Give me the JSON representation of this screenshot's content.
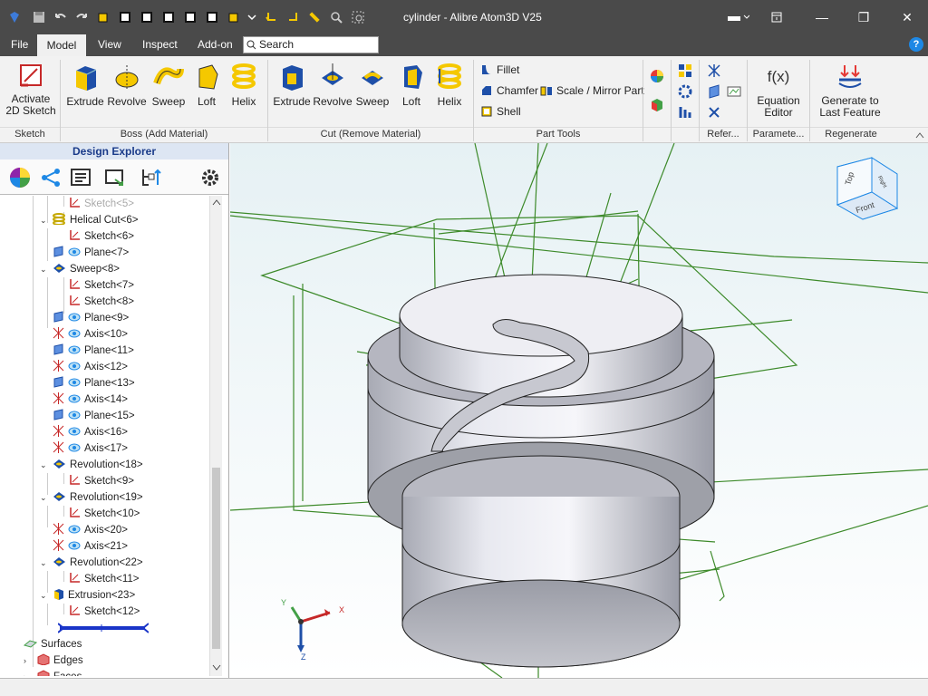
{
  "window": {
    "title": "cylinder - Alibre Atom3D V25",
    "minimize": "—",
    "maximize": "❐",
    "close": "✕"
  },
  "menu": {
    "file": "File",
    "model": "Model",
    "view": "View",
    "inspect": "Inspect",
    "addon": "Add-on",
    "search_placeholder": "Search",
    "help": "?"
  },
  "ribbon": {
    "sketch": {
      "activate": "Activate\n2D Sketch",
      "group": "Sketch"
    },
    "boss": {
      "extrude": "Extrude",
      "revolve": "Revolve",
      "sweep": "Sweep",
      "loft": "Loft",
      "helix": "Helix",
      "group": "Boss (Add Material)"
    },
    "cut": {
      "extrude": "Extrude",
      "revolve": "Revolve",
      "sweep": "Sweep",
      "loft": "Loft",
      "helix": "Helix",
      "group": "Cut (Remove Material)"
    },
    "tools": {
      "fillet": "Fillet",
      "chamfer": "Chamfer",
      "scale_mirror": "Scale / Mirror Part",
      "shell": "Shell",
      "group": "Part Tools"
    },
    "reference": {
      "group": "Refer..."
    },
    "parameters": {
      "equation": "Equation\nEditor",
      "fx": "f(x)",
      "group": "Paramete..."
    },
    "regenerate": {
      "generate": "Generate to\nLast Feature",
      "group": "Regenerate"
    }
  },
  "explorer": {
    "title": "Design Explorer",
    "nodes": [
      {
        "label": "Sketch<5>",
        "icon": "sketch-icon",
        "faded": true
      },
      {
        "label": "Helical Cut<6>",
        "icon": "helix-icon"
      },
      {
        "label": "Sketch<6>",
        "icon": "sketch-icon"
      },
      {
        "label": "Plane<7>",
        "icon": "plane-icon"
      },
      {
        "label": "Sweep<8>",
        "icon": "sweep-icon"
      },
      {
        "label": "Sketch<7>",
        "icon": "sketch-icon"
      },
      {
        "label": "Sketch<8>",
        "icon": "sketch-icon"
      },
      {
        "label": "Plane<9>",
        "icon": "plane-icon"
      },
      {
        "label": "Axis<10>",
        "icon": "axis-icon"
      },
      {
        "label": "Plane<11>",
        "icon": "plane-icon"
      },
      {
        "label": "Axis<12>",
        "icon": "axis-icon"
      },
      {
        "label": "Plane<13>",
        "icon": "plane-icon"
      },
      {
        "label": "Axis<14>",
        "icon": "axis-icon"
      },
      {
        "label": "Plane<15>",
        "icon": "plane-icon"
      },
      {
        "label": "Axis<16>",
        "icon": "axis-icon"
      },
      {
        "label": "Axis<17>",
        "icon": "axis-icon"
      },
      {
        "label": "Revolution<18>",
        "icon": "revolve-icon"
      },
      {
        "label": "Sketch<9>",
        "icon": "sketch-icon"
      },
      {
        "label": "Revolution<19>",
        "icon": "revolve-icon"
      },
      {
        "label": "Sketch<10>",
        "icon": "sketch-icon"
      },
      {
        "label": "Axis<20>",
        "icon": "axis-icon"
      },
      {
        "label": "Axis<21>",
        "icon": "axis-icon"
      },
      {
        "label": "Revolution<22>",
        "icon": "revolve-icon"
      },
      {
        "label": "Sketch<11>",
        "icon": "sketch-icon"
      },
      {
        "label": "Extrusion<23>",
        "icon": "extrude-icon"
      },
      {
        "label": "Sketch<12>",
        "icon": "sketch-icon"
      },
      {
        "label": "",
        "icon": "rollback-bar-icon"
      },
      {
        "label": "Surfaces",
        "icon": "surfaces-icon"
      },
      {
        "label": "Edges",
        "icon": "edges-icon"
      },
      {
        "label": "Faces",
        "icon": "faces-icon"
      }
    ]
  },
  "viewcube": {
    "top": "Top",
    "front": "Front",
    "right": "Right"
  },
  "axes": {
    "x": "X",
    "y": "Y",
    "z": "Z"
  }
}
